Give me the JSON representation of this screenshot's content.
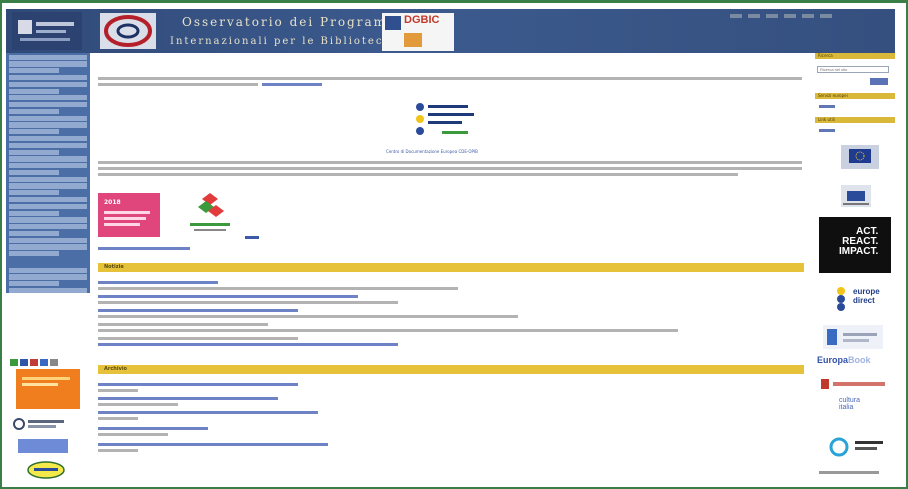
{
  "header": {
    "title_line1": "Osservatorio dei Programmi",
    "title_line2": "Internazionali per le Biblioteche",
    "dgbic": "DGBIC"
  },
  "main": {
    "cde_caption": "Centro di Documentazione Europea CDE-OPIB",
    "sections": [
      {
        "label": "Notizie"
      },
      {
        "label": "Archivio"
      }
    ]
  },
  "banner": {
    "year": "2018"
  },
  "right": {
    "search_head": "Ricerca",
    "search_placeholder": "Ricerca nel sito",
    "link_head_1": "Servizi europei",
    "link_head_2": "Link utili",
    "act_line1": "ACT.",
    "act_line2": "REACT.",
    "act_line3": "IMPACT.",
    "europe_line1": "europe",
    "europe_line2": "direct",
    "europabook_main": "Europa",
    "europabook_faded": "Book",
    "cultura_line1": "cultura",
    "cultura_line2": "italia"
  },
  "colors": {
    "header_bg": "#35507f",
    "sidebar_bg": "#4b6ea6",
    "section_bar": "#e6c23a",
    "frame": "#3a7f45",
    "orange": "#f07d1e",
    "pink": "#e0457b"
  }
}
